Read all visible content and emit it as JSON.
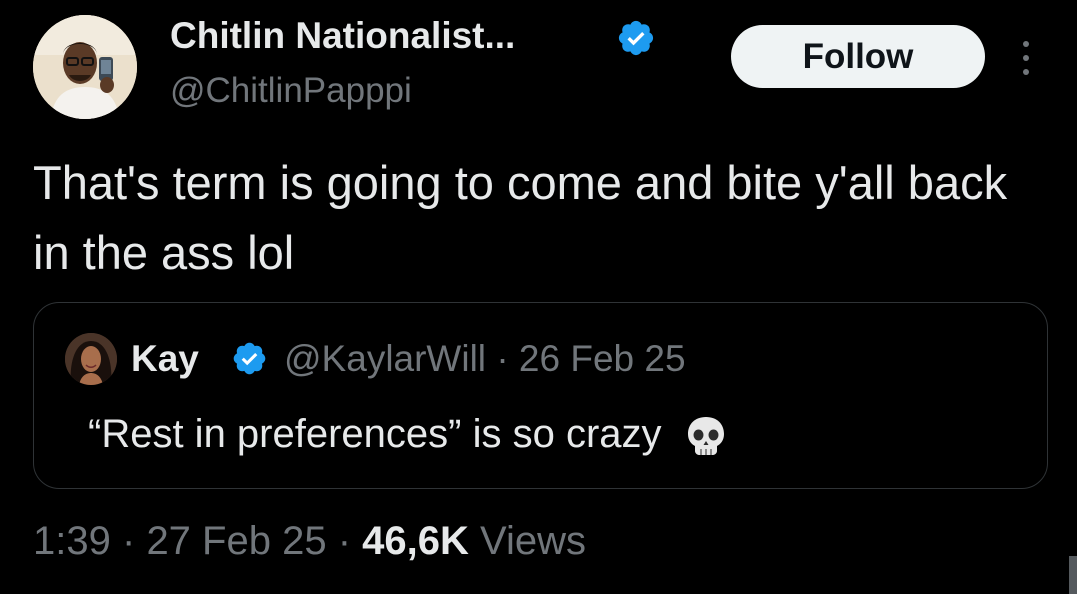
{
  "author": {
    "display_name": "Chitlin Nationalist...",
    "handle": "@ChitlinPapppi",
    "verified": true
  },
  "actions": {
    "follow_label": "Follow",
    "more_icon": "more-vertical-icon"
  },
  "tweet": {
    "text": "That's term is going to come and bite y'all back in the ass lol"
  },
  "quote": {
    "display_name": "Kay",
    "verified": true,
    "handle": "@KaylarWill",
    "separator": "·",
    "date": "26 Feb 25",
    "text": "“Rest in preferences” is so crazy",
    "emoji": "skull-emoji"
  },
  "footer": {
    "time": "1:39",
    "separator": "·",
    "date": "27 Feb 25",
    "views_count": "46,6K",
    "views_label": "Views"
  },
  "colors": {
    "background": "#000000",
    "primary_text": "#e7e9ea",
    "secondary_text": "#71767b",
    "verified_blue": "#1d9bf0",
    "border": "#2f3336",
    "follow_bg": "#eff3f4"
  }
}
